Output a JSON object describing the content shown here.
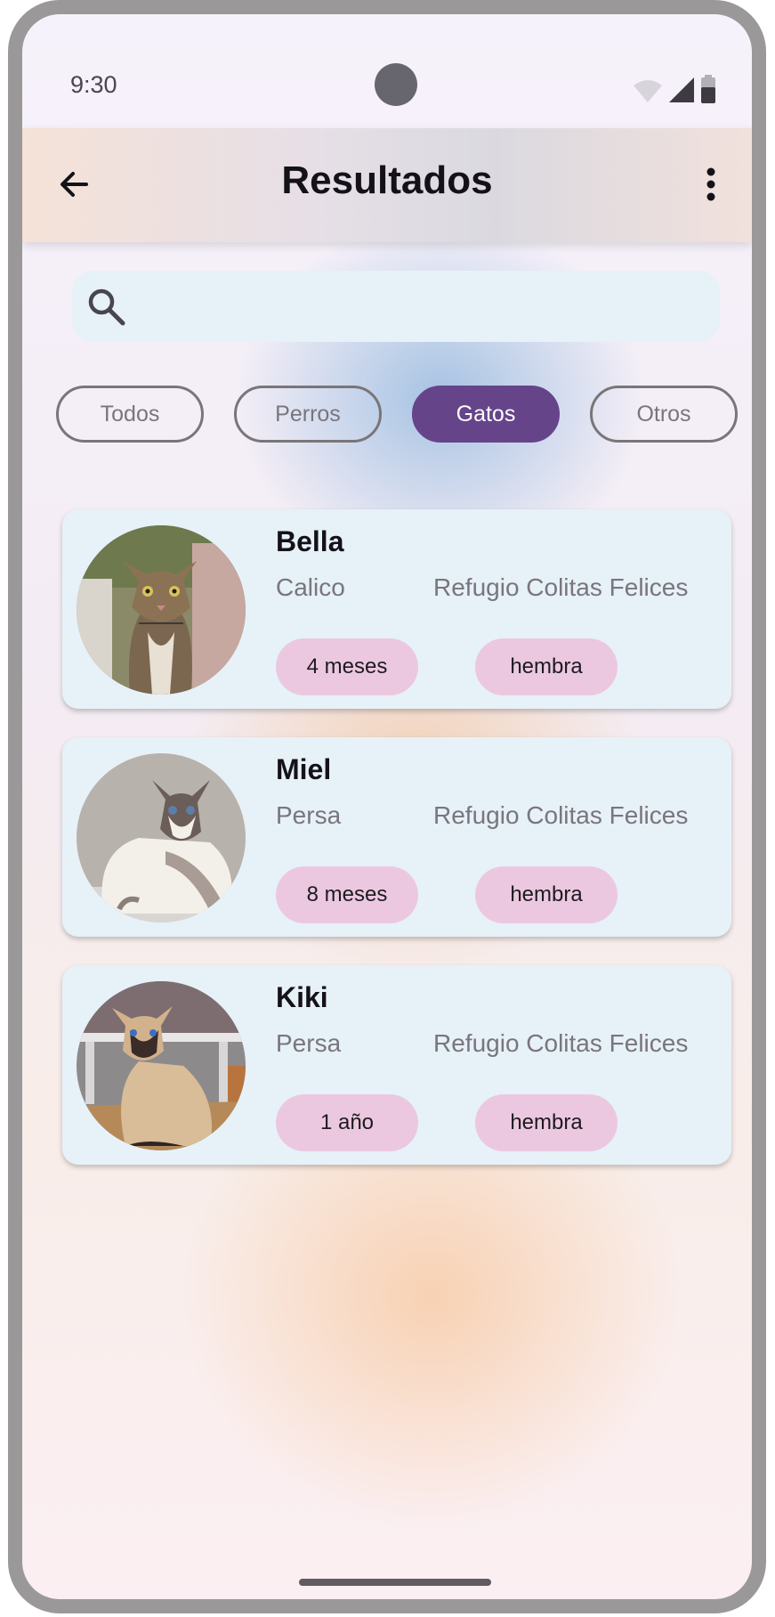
{
  "status_bar": {
    "time": "9:30"
  },
  "app_bar": {
    "title": "Resultados",
    "back_icon": "arrow-back-icon",
    "menu_icon": "more-vert-icon"
  },
  "search": {
    "placeholder": "",
    "value": ""
  },
  "filters": [
    {
      "label": "Todos",
      "selected": false
    },
    {
      "label": "Perros",
      "selected": false
    },
    {
      "label": "Gatos",
      "selected": true
    },
    {
      "label": "Otros",
      "selected": false
    }
  ],
  "results": [
    {
      "name": "Bella",
      "breed": "Calico",
      "shelter": "Refugio Colitas Felices",
      "age": "4 meses",
      "sex": "hembra",
      "photo": "tabby-cat-photo"
    },
    {
      "name": "Miel",
      "breed": "Persa",
      "shelter": "Refugio Colitas Felices",
      "age": "8 meses",
      "sex": "hembra",
      "photo": "ragdoll-cat-photo"
    },
    {
      "name": "Kiki",
      "breed": "Persa",
      "shelter": "Refugio Colitas Felices",
      "age": "1 año",
      "sex": "hembra",
      "photo": "siamese-cat-photo"
    }
  ],
  "colors": {
    "chip_selected": "#66448a",
    "tag_background": "#ecc8e0",
    "card_background": "#e7f1f8"
  }
}
